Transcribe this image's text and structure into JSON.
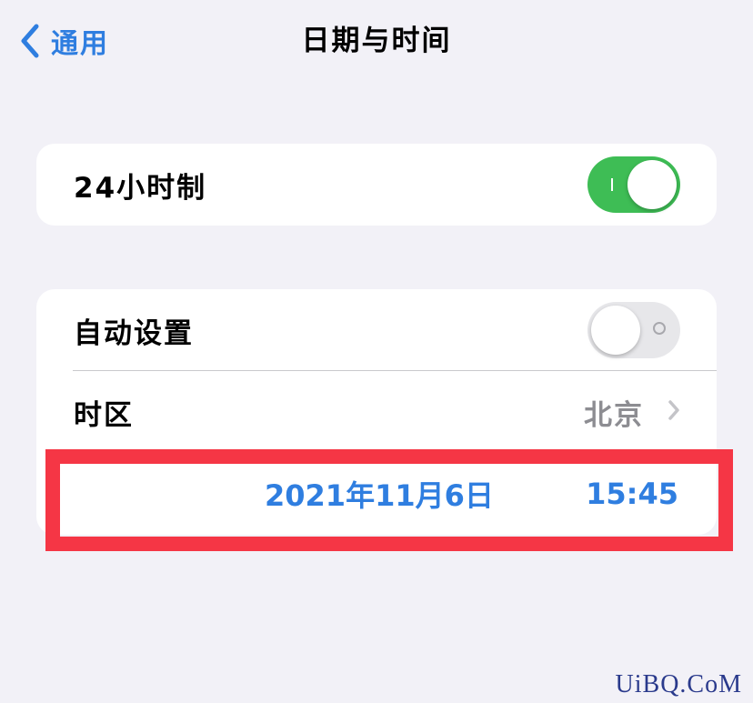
{
  "nav": {
    "back_label": "通用",
    "back_icon": "chevron-left-icon",
    "title": "日期与时间"
  },
  "group1": {
    "hour24_label": "24小时制",
    "hour24_on": true
  },
  "group2": {
    "auto_set_label": "自动设置",
    "auto_set_on": false,
    "timezone_label": "时区",
    "timezone_value": "北京",
    "date": "2021年11月6日",
    "time": "15:45"
  },
  "colors": {
    "background": "#f2f1f7",
    "accent_blue": "#2f7ee0",
    "toggle_green": "#3ebd55",
    "highlight_red": "#f53645"
  },
  "watermark": "UiBQ.CoM"
}
